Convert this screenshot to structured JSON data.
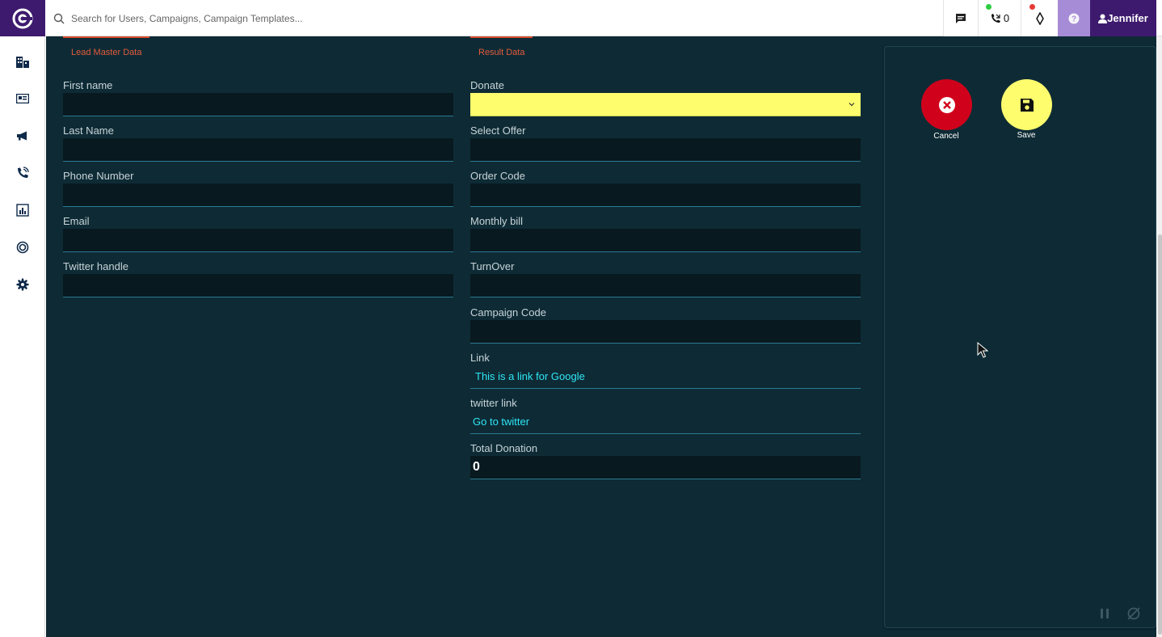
{
  "search": {
    "placeholder": "Search for Users, Campaigns, Campaign Templates..."
  },
  "topbar": {
    "chat_icon": "chat-icon",
    "calls_count": "0",
    "user_name": "Jennifer",
    "help_icon": "help-icon",
    "status_colors": {
      "green": "#2ecc40",
      "red": "#e53935"
    }
  },
  "rail": [
    "building-icon",
    "card-icon",
    "megaphone-icon",
    "phone-icon",
    "chart-icon",
    "target-icon",
    "gear-icon"
  ],
  "sections": {
    "left_title": "Lead Master Data",
    "right_title": "Result Data"
  },
  "left_fields": [
    {
      "label": "First name",
      "value": ""
    },
    {
      "label": "Last Name",
      "value": ""
    },
    {
      "label": "Phone Number",
      "value": ""
    },
    {
      "label": "Email",
      "value": ""
    },
    {
      "label": "Twitter handle",
      "value": ""
    }
  ],
  "right_fields": {
    "donate": {
      "label": "Donate",
      "value": ""
    },
    "select_offer": {
      "label": "Select Offer",
      "value": ""
    },
    "order_code": {
      "label": "Order Code",
      "value": ""
    },
    "monthly_bill": {
      "label": "Monthly bill",
      "value": ""
    },
    "turnover": {
      "label": "TurnOver",
      "value": ""
    },
    "campaign_code": {
      "label": "Campaign Code",
      "value": ""
    },
    "link": {
      "label": "Link",
      "value": "This is a link for Google"
    },
    "twitter_link": {
      "label": "twitter link",
      "value": "Go to twitter"
    },
    "total_donation": {
      "label": "Total Donation",
      "value": "0"
    }
  },
  "actions": {
    "cancel_label": "Cancel",
    "save_label": "Save",
    "cancel_color": "#d0021b",
    "save_color": "#fdfd6e"
  }
}
